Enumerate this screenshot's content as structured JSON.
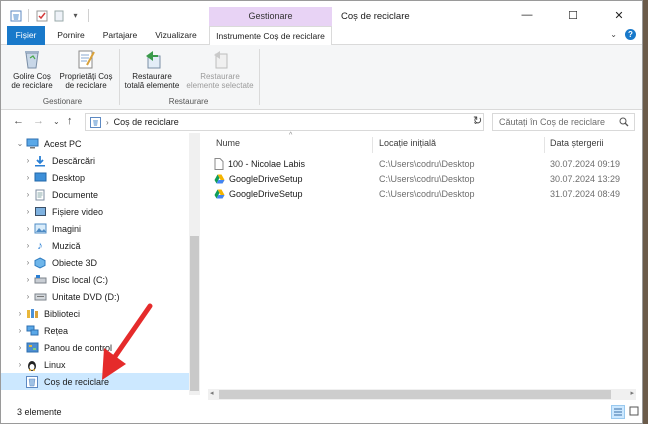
{
  "window": {
    "title": "Coș de reciclare"
  },
  "titlebar": {
    "context_group": "Gestionare"
  },
  "ribbon": {
    "tabs": [
      "Fișier",
      "Pornire",
      "Partajare",
      "Vizualizare",
      "Instrumente Coș de reciclare"
    ],
    "groups": [
      {
        "label": "Gestionare",
        "buttons": [
          {
            "line1": "Golire Coș",
            "line2": "de reciclare",
            "icon": "recycle-bin-empty-icon",
            "enabled": true
          },
          {
            "line1": "Proprietăți Coș",
            "line2": "de reciclare",
            "icon": "properties-icon",
            "enabled": true
          }
        ]
      },
      {
        "label": "Restaurare",
        "buttons": [
          {
            "line1": "Restaurare",
            "line2": "totală elemente",
            "icon": "restore-all-icon",
            "enabled": true
          },
          {
            "line1": "Restaurare",
            "line2": "elemente selectate",
            "icon": "restore-selected-icon",
            "enabled": false
          }
        ]
      }
    ]
  },
  "address": {
    "path": "Coș de reciclare"
  },
  "search": {
    "placeholder": "Căutați în Coș de reciclare"
  },
  "nav": {
    "items": [
      {
        "label": "Acest PC",
        "icon": "pc-icon",
        "expanded": true
      },
      {
        "label": "Descărcări",
        "icon": "downloads-icon"
      },
      {
        "label": "Desktop",
        "icon": "desktop-icon"
      },
      {
        "label": "Documente",
        "icon": "documents-icon"
      },
      {
        "label": "Fișiere video",
        "icon": "videos-icon"
      },
      {
        "label": "Imagini",
        "icon": "pictures-icon"
      },
      {
        "label": "Muzică",
        "icon": "music-icon"
      },
      {
        "label": "Obiecte 3D",
        "icon": "objects-3d-icon"
      },
      {
        "label": "Disc local (C:)",
        "icon": "disk-icon"
      },
      {
        "label": "Unitate DVD (D:)",
        "icon": "dvd-icon"
      },
      {
        "label": "Biblioteci",
        "icon": "libraries-icon"
      },
      {
        "label": "Rețea",
        "icon": "network-icon"
      },
      {
        "label": "Panou de control",
        "icon": "control-panel-icon"
      },
      {
        "label": "Linux",
        "icon": "linux-icon"
      },
      {
        "label": "Coș de reciclare",
        "icon": "recycle-bin-icon",
        "selected": true
      }
    ]
  },
  "columns": {
    "name": "Nume",
    "location": "Locație inițială",
    "date": "Data ștergerii"
  },
  "files": [
    {
      "name": "100 - Nicolae Labis",
      "location": "C:\\Users\\codru\\Desktop",
      "date": "30.07.2024 09:19",
      "icon": "document-file-icon"
    },
    {
      "name": "GoogleDriveSetup",
      "location": "C:\\Users\\codru\\Desktop",
      "date": "30.07.2024 13:29",
      "icon": "google-drive-icon"
    },
    {
      "name": "GoogleDriveSetup",
      "location": "C:\\Users\\codru\\Desktop",
      "date": "31.07.2024 08:49",
      "icon": "google-drive-icon"
    }
  ],
  "status": {
    "count": "3 elemente"
  },
  "colors": {
    "accent": "#1979ca",
    "context_tab": "#e8d3f5",
    "selection": "#cce8ff",
    "arrow": "#e52b2b"
  }
}
